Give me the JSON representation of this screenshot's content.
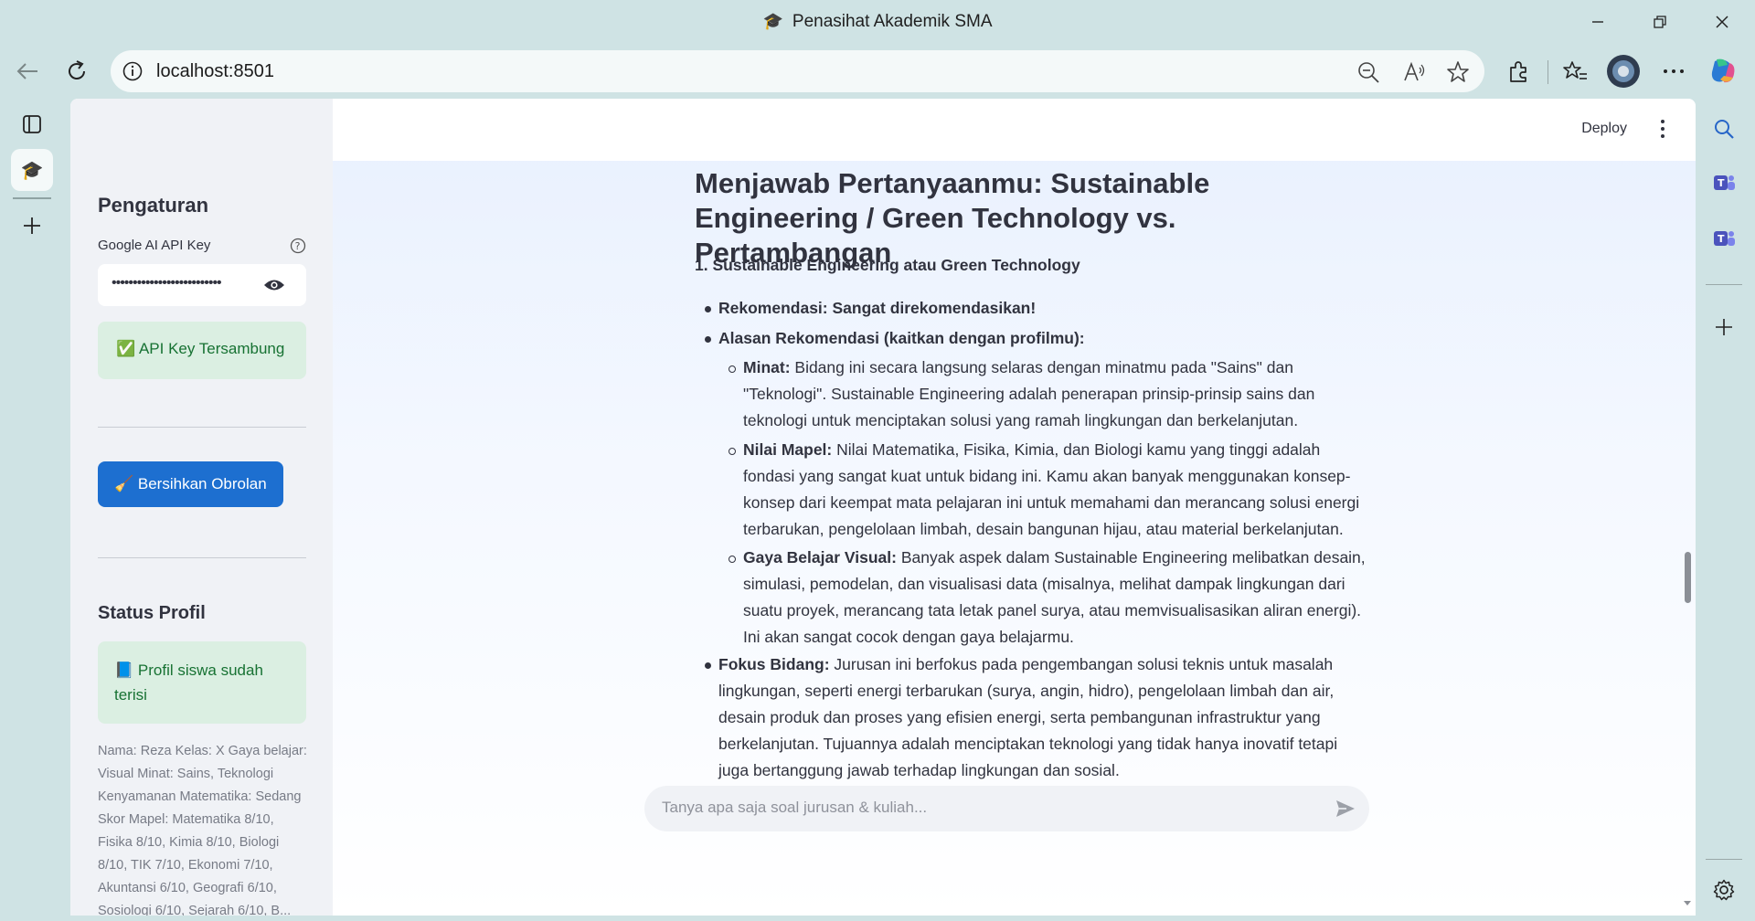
{
  "window": {
    "title": "Penasihat Akademik SMA"
  },
  "browser": {
    "url": "localhost:8501"
  },
  "app_header": {
    "deploy_label": "Deploy"
  },
  "sidebar": {
    "settings_title": "Pengaturan",
    "api_key_label": "Google AI API Key",
    "api_key_value": "••••••••••••••••••••••••••",
    "api_status": "✅ API Key Tersambung",
    "clear_button": "🧹 Bersihkan Obrolan",
    "profile_title": "Status Profil",
    "profile_status": "📘 Profil siswa sudah terisi",
    "profile_details": "Nama: Reza Kelas: X Gaya belajar: Visual Minat: Sains, Teknologi Kenyamanan Matematika: Sedang Skor Mapel: Matematika 8/10, Fisika 8/10, Kimia 8/10, Biologi 8/10, TIK 7/10, Ekonomi 7/10, Akuntansi 6/10, Geografi 6/10, Sosiologi 6/10, Sejarah 6/10, B..."
  },
  "chat": {
    "heading": "Menjawab Pertanyaanmu: Sustainable Engineering / Green Technology vs. Pertambangan",
    "section_title": "1. Sustainable Engineering atau Green Technology",
    "items": [
      {
        "label": "Rekomendasi: Sangat direkomendasikan!",
        "text": ""
      },
      {
        "label": "Alasan Rekomendasi (kaitkan dengan profilmu):",
        "text": ""
      }
    ],
    "subitems": [
      {
        "label": "Minat:",
        "text": " Bidang ini secara langsung selaras dengan minatmu pada \"Sains\" dan \"Teknologi\". Sustainable Engineering adalah penerapan prinsip-prinsip sains dan teknologi untuk menciptakan solusi yang ramah lingkungan dan berkelanjutan."
      },
      {
        "label": "Nilai Mapel:",
        "text": " Nilai Matematika, Fisika, Kimia, dan Biologi kamu yang tinggi adalah fondasi yang sangat kuat untuk bidang ini. Kamu akan banyak menggunakan konsep-konsep dari keempat mata pelajaran ini untuk memahami dan merancang solusi energi terbarukan, pengelolaan limbah, desain bangunan hijau, atau material berkelanjutan."
      },
      {
        "label": "Gaya Belajar Visual:",
        "text": " Banyak aspek dalam Sustainable Engineering melibatkan desain, simulasi, pemodelan, dan visualisasi data (misalnya, melihat dampak lingkungan dari suatu proyek, merancang tata letak panel surya, atau memvisualisasikan aliran energi). Ini akan sangat cocok dengan gaya belajarmu."
      }
    ],
    "focus": {
      "label": "Fokus Bidang:",
      "text": " Jurusan ini berfokus pada pengembangan solusi teknis untuk masalah lingkungan, seperti energi terbarukan (surya, angin, hidro), pengelolaan limbah dan air, desain produk dan proses yang efisien energi, serta pembangunan infrastruktur yang berkelanjutan. Tujuannya adalah menciptakan teknologi yang tidak hanya inovatif tetapi juga bertanggung jawab terhadap lingkungan dan sosial."
    },
    "input_placeholder": "Tanya apa saja soal jurusan & kuliah..."
  },
  "icons": {
    "tab_favicon": "graduation-cap-icon",
    "accent": "#1d6fd0",
    "success_bg": "#dbefe2",
    "success_text": "#177233"
  }
}
